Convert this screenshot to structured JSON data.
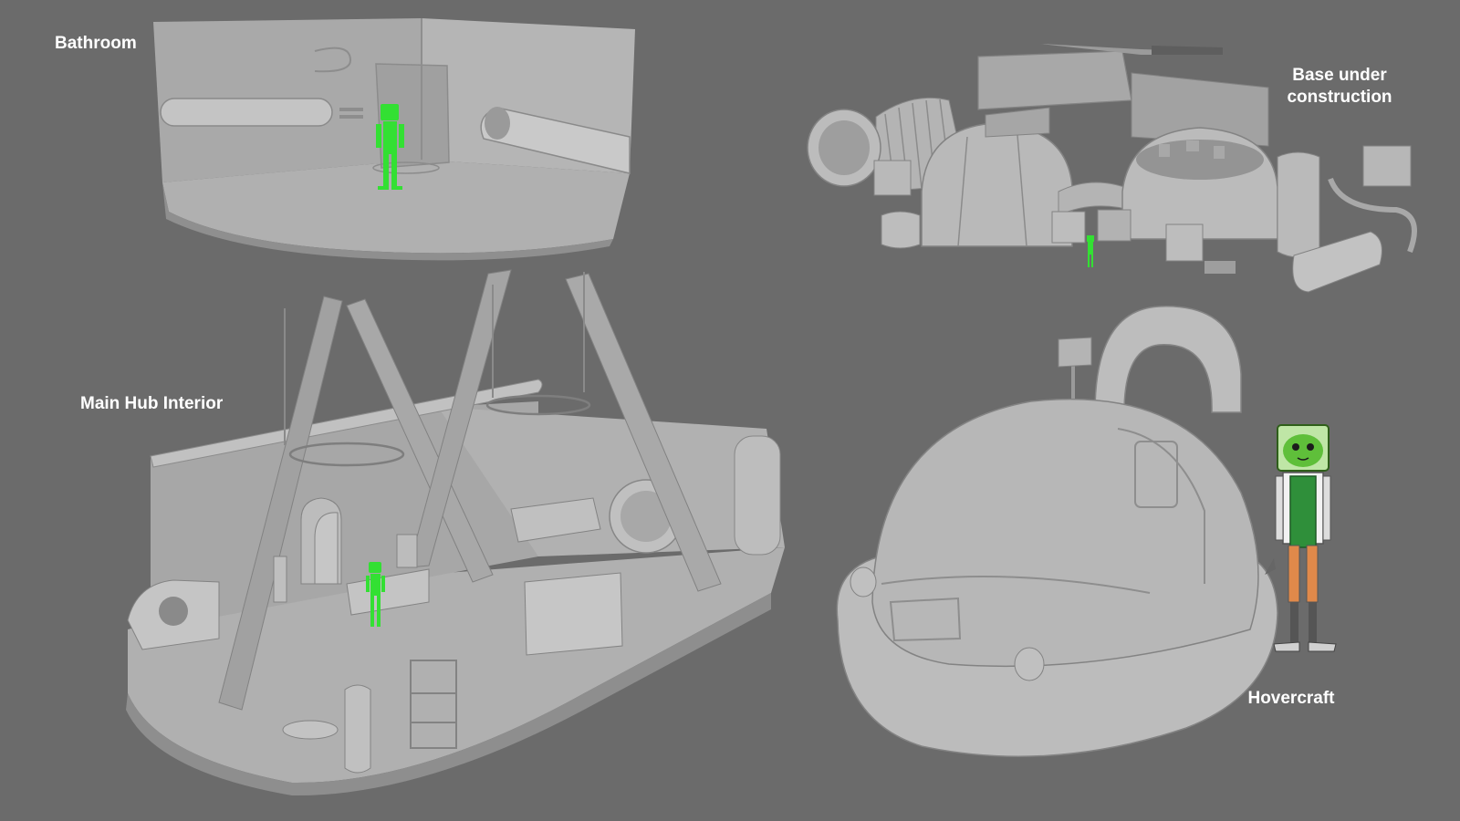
{
  "labels": {
    "bathroom": "Bathroom",
    "base_line1": "Base under",
    "base_line2": "construction",
    "main_hub": "Main Hub Interior",
    "hovercraft": "Hovercraft"
  },
  "colors": {
    "background": "#6b6b6b",
    "model_light": "#b8b8b8",
    "model_mid": "#a3a3a3",
    "model_dark": "#7e7e7e",
    "figure_green": "#2ee62e",
    "label_text": "#ffffff"
  },
  "panels": [
    {
      "name": "bathroom",
      "label_key": "bathroom"
    },
    {
      "name": "base-under-construction",
      "label_key": "base_line1"
    },
    {
      "name": "main-hub-interior",
      "label_key": "main_hub"
    },
    {
      "name": "hovercraft",
      "label_key": "hovercraft"
    }
  ]
}
